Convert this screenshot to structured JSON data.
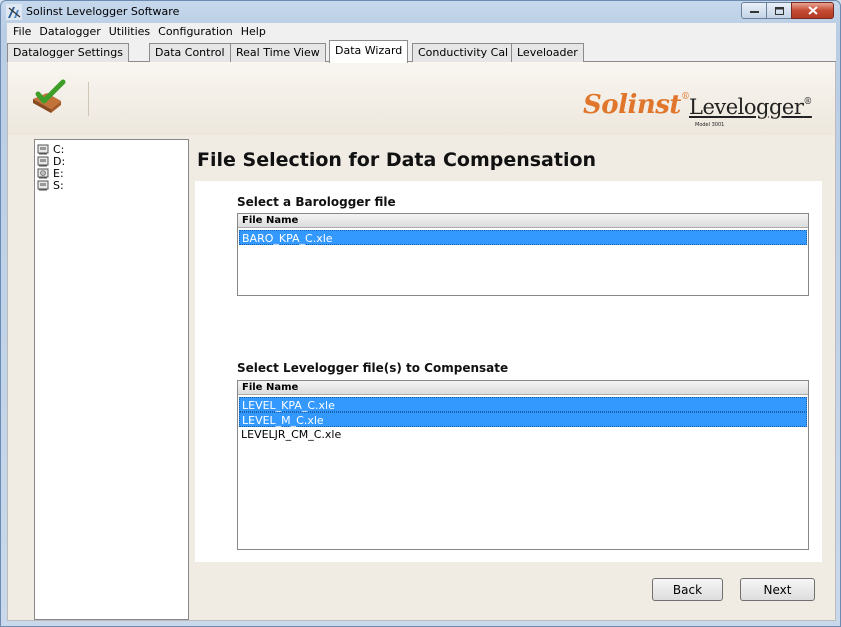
{
  "window": {
    "title": "Solinst Levelogger Software"
  },
  "menu": [
    "File",
    "Datalogger",
    "Utilities",
    "Configuration",
    "Help"
  ],
  "tabs": [
    {
      "label": "Datalogger Settings",
      "active": false
    },
    {
      "label": "Data Control",
      "active": false
    },
    {
      "label": "Real Time View",
      "active": false
    },
    {
      "label": "Data Wizard",
      "active": true
    },
    {
      "label": "Conductivity Cal",
      "active": false
    },
    {
      "label": "Leveloader",
      "active": false
    }
  ],
  "branding": {
    "solinst": "Solinst",
    "levelogger": "Levelogger",
    "model": "Model 3001",
    "solinst_color": "#e0762b"
  },
  "drives": [
    {
      "label": "C:",
      "icon": "hard-drive-icon"
    },
    {
      "label": "D:",
      "icon": "hard-drive-icon"
    },
    {
      "label": "E:",
      "icon": "cd-drive-icon"
    },
    {
      "label": "S:",
      "icon": "hard-drive-icon"
    }
  ],
  "main": {
    "title": "File Selection for Data Compensation",
    "barologger": {
      "label": "Select a Barologger file",
      "column": "File Name",
      "files": [
        {
          "name": "BARO_KPA_C.xle",
          "selected": true
        }
      ]
    },
    "levelogger": {
      "label": "Select Levelogger file(s) to Compensate",
      "column": "File Name",
      "files": [
        {
          "name": "LEVEL_KPA_C.xle",
          "selected": true
        },
        {
          "name": "LEVEL_M_C.xle",
          "selected": true
        },
        {
          "name": "LEVELJR_CM_C.xle",
          "selected": false
        }
      ]
    }
  },
  "buttons": {
    "back": "Back",
    "next": "Next"
  },
  "colors": {
    "selection": "#3399ff",
    "panel_bg": "#f0ece4"
  }
}
